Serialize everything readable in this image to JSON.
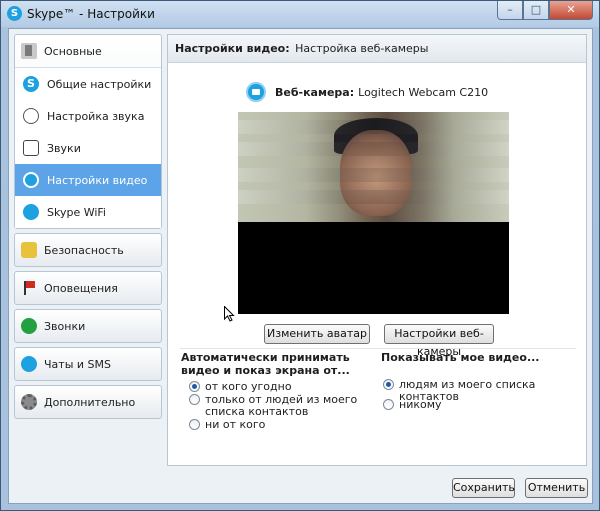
{
  "window": {
    "title": "Skype™ - Настройки",
    "app_icon_glyph": "S"
  },
  "controls": {
    "minimize": "–",
    "maximize": "□",
    "close": "✕"
  },
  "sidebar": {
    "groups": [
      {
        "label": "Основные",
        "icon": "home-icon",
        "expanded": true,
        "items": [
          {
            "label": "Общие настройки",
            "icon": "skype-icon",
            "active": false
          },
          {
            "label": "Настройка звука",
            "icon": "sound-icon",
            "active": false
          },
          {
            "label": "Звуки",
            "icon": "speaker-icon",
            "active": false
          },
          {
            "label": "Настройки видео",
            "icon": "video-icon",
            "active": true
          },
          {
            "label": "Skype WiFi",
            "icon": "wifi-icon",
            "active": false
          }
        ]
      },
      {
        "label": "Безопасность",
        "icon": "key-icon"
      },
      {
        "label": "Оповещения",
        "icon": "flag-icon"
      },
      {
        "label": "Звонки",
        "icon": "phone-icon"
      },
      {
        "label": "Чаты и SMS",
        "icon": "chat-icon"
      },
      {
        "label": "Дополнительно",
        "icon": "gear-icon"
      }
    ]
  },
  "panel": {
    "title": "Настройки видео:",
    "subtitle": "Настройка веб-камеры",
    "webcam_label": "Веб-камера:",
    "webcam_name": "Logitech Webcam C210",
    "change_avatar": "Изменить аватар",
    "webcam_settings": "Настройки веб-камеры",
    "auto_accept_title": "Автоматически принимать видео и показ экрана от...",
    "auto_accept_options": [
      {
        "label": "от кого угодно",
        "selected": true
      },
      {
        "label": "только от людей из моего списка контактов",
        "selected": false
      },
      {
        "label": "ни от кого",
        "selected": false
      }
    ],
    "show_video_title": "Показывать мое видео...",
    "show_video_options": [
      {
        "label": "людям из моего списка контактов",
        "selected": true
      },
      {
        "label": "никому",
        "selected": false
      }
    ]
  },
  "footer": {
    "save": "Сохранить",
    "cancel": "Отменить"
  },
  "colors": {
    "accent": "#1ea1e0",
    "active_item": "#5da3e8",
    "frame": "#a8c2de"
  }
}
